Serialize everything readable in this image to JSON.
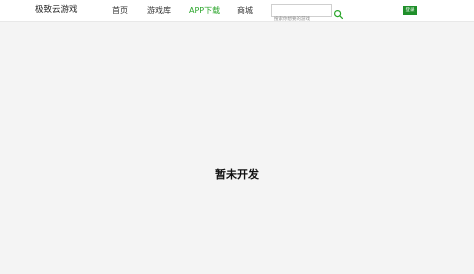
{
  "header": {
    "logo_text": "极致云游戏",
    "nav": [
      {
        "label": "首页",
        "active": false
      },
      {
        "label": "游戏库",
        "active": false
      },
      {
        "label": "APP下载",
        "active": true
      },
      {
        "label": "商城",
        "active": false
      }
    ],
    "search": {
      "placeholder": "搜索你想要的游戏",
      "value": "",
      "icon": "search-icon"
    },
    "login_label": "登录"
  },
  "main": {
    "message": "暂未开发"
  },
  "colors": {
    "accent": "#2aa52a",
    "login_bg": "#1f8f2a",
    "page_bg": "#f4f4f4",
    "header_bg": "#ffffff"
  }
}
